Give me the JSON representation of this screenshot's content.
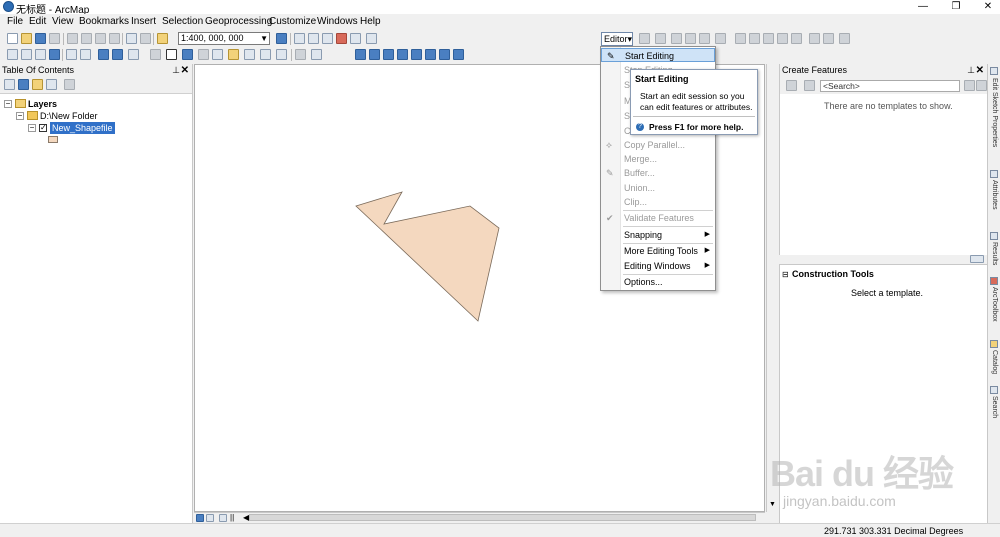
{
  "window": {
    "title": "无标题 - ArcMap"
  },
  "menubar": [
    "File",
    "Edit",
    "View",
    "Bookmarks",
    "Insert",
    "Selection",
    "Geoprocessing",
    "Customize",
    "Windows",
    "Help"
  ],
  "toolbar": {
    "scale_value": "1:400, 000, 000",
    "editor_label": "Editor▾"
  },
  "toc": {
    "title": "Table Of Contents",
    "root": "Layers",
    "folder": "D:\\New Folder",
    "layer": "New_Shapefile"
  },
  "editor_menu": {
    "items": [
      {
        "label": "Start Editing",
        "state": "highlighted"
      },
      {
        "label": "Stop Editing",
        "state": "disabled"
      },
      {
        "label": "Save Edits",
        "state": "disabled"
      },
      {
        "label": "Move...",
        "state": "disabled"
      },
      {
        "label": "Split...",
        "state": "disabled"
      },
      {
        "label": "Construct Points...",
        "state": "disabled"
      },
      {
        "label": "Copy Parallel...",
        "state": "disabled"
      },
      {
        "label": "Merge...",
        "state": "disabled"
      },
      {
        "label": "Buffer...",
        "state": "disabled"
      },
      {
        "label": "Union...",
        "state": "disabled"
      },
      {
        "label": "Clip...",
        "state": "disabled"
      },
      {
        "label": "Validate Features",
        "state": "disabled"
      },
      {
        "label": "Snapping",
        "state": "submenu"
      },
      {
        "label": "More Editing Tools",
        "state": "submenu"
      },
      {
        "label": "Editing Windows",
        "state": "submenu"
      },
      {
        "label": "Options...",
        "state": "normal"
      }
    ]
  },
  "tooltip": {
    "title": "Start Editing",
    "body": "Start an edit session so you can edit features or attributes.",
    "help": "Press F1 for more help."
  },
  "create_features": {
    "title": "Create Features",
    "search_placeholder": "<Search>",
    "empty_message": "There are no templates to show."
  },
  "construction_tools": {
    "title": "Construction Tools",
    "message": "Select a template."
  },
  "side_tabs": [
    "Edit Sketch Properties",
    "Attributes",
    "Results",
    "ArcToolbox",
    "Catalog",
    "Search"
  ],
  "status": {
    "coordinates": "291.731  303.331 Decimal Degrees"
  },
  "watermark": {
    "brand": "Bai du 经验",
    "url": "jingyan.baidu.com"
  },
  "colors": {
    "polygon_fill": "#f4d8bf",
    "selection": "#3070c8",
    "menu_highlight": "#cfe3f7"
  },
  "icons": [
    "globe-app-icon",
    "new-icon",
    "open-icon",
    "save-icon",
    "undo-icon",
    "redo-icon",
    "zoom-in-icon",
    "zoom-out-icon",
    "pan-icon",
    "select-icon",
    "identify-icon",
    "folder-icon",
    "help-icon"
  ]
}
